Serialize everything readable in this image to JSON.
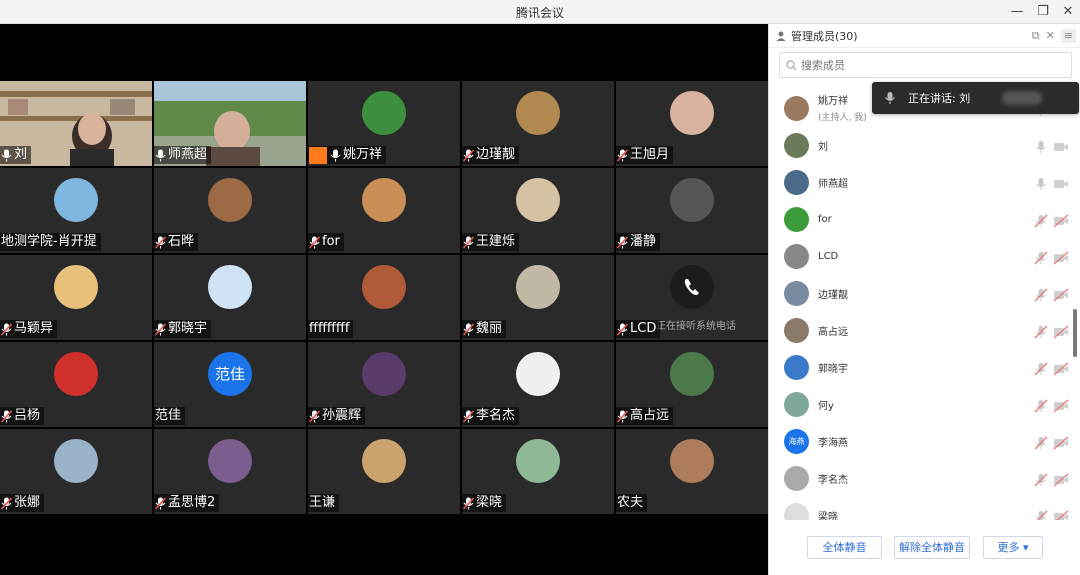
{
  "window": {
    "title": "腾讯会议"
  },
  "tiles": [
    {
      "name": "刘",
      "mic": "on",
      "kind": "video1"
    },
    {
      "name": "师燕超",
      "mic": "on",
      "kind": "video2"
    },
    {
      "name": "姚万祥",
      "mic": "on",
      "host": true,
      "kind": "photo"
    },
    {
      "name": "边瑾靓",
      "mic": "off",
      "kind": "photo"
    },
    {
      "name": "王旭月",
      "mic": "off",
      "kind": "photo"
    },
    {
      "name": "地测学院-肖开提",
      "mic": "none",
      "kind": "photo"
    },
    {
      "name": "石晔",
      "mic": "off",
      "kind": "photo"
    },
    {
      "name": "for",
      "mic": "off",
      "kind": "photo"
    },
    {
      "name": "王建烁",
      "mic": "off",
      "kind": "photo"
    },
    {
      "name": "潘静",
      "mic": "off",
      "kind": "photo"
    },
    {
      "name": "马颖异",
      "mic": "off",
      "kind": "photo"
    },
    {
      "name": "郭晓宇",
      "mic": "off",
      "kind": "photo"
    },
    {
      "name": "fffffffff",
      "mic": "none",
      "kind": "photo"
    },
    {
      "name": "魏丽",
      "mic": "off",
      "kind": "photo"
    },
    {
      "name": "LCD",
      "mic": "off",
      "kind": "phone",
      "overlay": "正在接听系统电话"
    },
    {
      "name": "吕杨",
      "mic": "off",
      "kind": "photo"
    },
    {
      "name": "范佳",
      "mic": "none",
      "kind": "text",
      "avatar_text": "范佳"
    },
    {
      "name": "孙震辉",
      "mic": "off",
      "kind": "photo"
    },
    {
      "name": "李名杰",
      "mic": "off",
      "kind": "photo"
    },
    {
      "name": "高占远",
      "mic": "off",
      "kind": "photo"
    },
    {
      "name": "张娜",
      "mic": "off",
      "kind": "photo"
    },
    {
      "name": "孟思博2",
      "mic": "off",
      "kind": "photo"
    },
    {
      "name": "王谦",
      "mic": "none",
      "kind": "photo"
    },
    {
      "name": "梁晓",
      "mic": "off",
      "kind": "photo"
    },
    {
      "name": "农夫",
      "mic": "none",
      "kind": "photo"
    }
  ],
  "panel": {
    "title": "管理成员(30)",
    "search_placeholder": "搜索成员",
    "members": [
      {
        "name": "姚万祥",
        "sub": "(主持人, 我)",
        "mic": "on"
      },
      {
        "name": "刘",
        "mic": "on"
      },
      {
        "name": "师燕超",
        "mic": "on"
      },
      {
        "name": "for",
        "mic": "off"
      },
      {
        "name": "LCD",
        "mic": "off"
      },
      {
        "name": "边瑾靓",
        "mic": "off"
      },
      {
        "name": "高占远",
        "mic": "off"
      },
      {
        "name": "郭晓宇",
        "mic": "off"
      },
      {
        "name": "何y",
        "mic": "off"
      },
      {
        "name": "李海燕",
        "mic": "off",
        "avatar_text": "海燕"
      },
      {
        "name": "李名杰",
        "mic": "off"
      },
      {
        "name": "梁晓",
        "mic": "off"
      }
    ],
    "buttons": {
      "mute_all": "全体静音",
      "unmute_all": "解除全体静音",
      "more": "更多"
    }
  },
  "speaking": {
    "label": "正在讲话: 刘"
  },
  "colors": {
    "accent": "#1a73e8",
    "host_badge": "#ff7a1a",
    "mic_muted": "#e05555",
    "video_bg": "#000000",
    "tile_bg": "#2a2a2a"
  }
}
